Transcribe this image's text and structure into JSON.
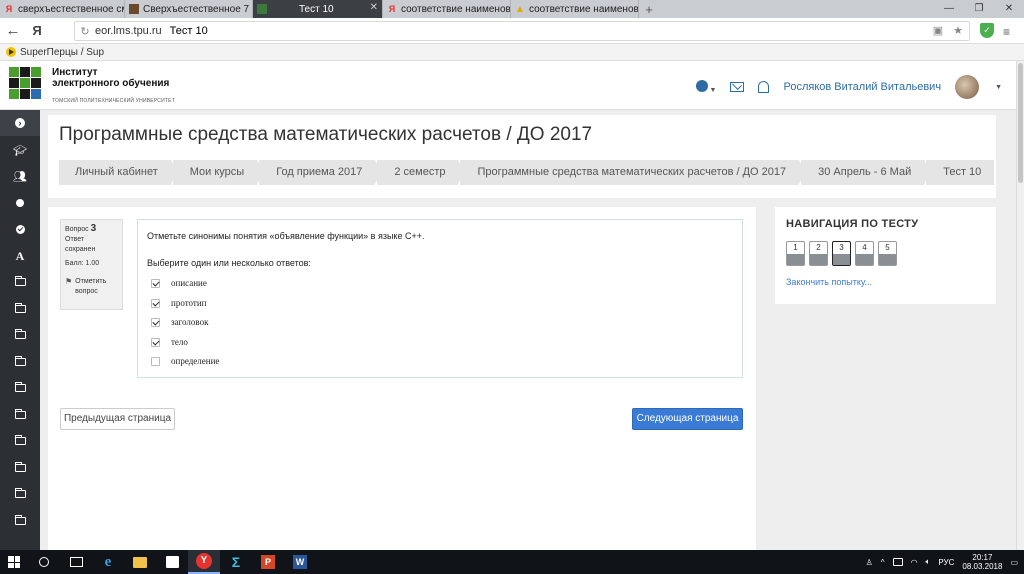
{
  "browser": {
    "tabs": [
      {
        "label": "сверхъестественное смотр",
        "icon": "yandex-icon",
        "active": false
      },
      {
        "label": "Сверхъестественное 7 сезо",
        "icon": "image-thumbnail-icon",
        "active": false
      },
      {
        "label": "Тест 10",
        "icon": "lms-favicon-icon",
        "active": true
      },
      {
        "label": "соответствие наименован",
        "icon": "yandex-icon",
        "active": false
      },
      {
        "label": "соответствие наименован",
        "icon": "warning-icon",
        "active": false
      }
    ],
    "domain": "eor.lms.tpu.ru",
    "page_title": "Тест 10",
    "bookmark": "SuperПерцы / Sup"
  },
  "header": {
    "org_line1": "Институт",
    "org_line2": "электронного обучения",
    "org_sub": "ТОМСКИЙ ПОЛИТЕХНИЧЕСКИЙ УНИВЕРСИТЕТ",
    "user_name": "Росляков Виталий Витальевич"
  },
  "page": {
    "title": "Программные средства математических расчетов / ДО 2017",
    "breadcrumbs": [
      "Личный кабинет",
      "Мои курсы",
      "Год приема 2017",
      "2 семестр",
      "Программные средства математических расчетов / ДО 2017",
      "30 Апрель - 6 Май",
      "Тест 10"
    ]
  },
  "question": {
    "label": "Вопрос",
    "number": "3",
    "state_line1": "Ответ",
    "state_line2": "сохранен",
    "grade": "Балл: 1.00",
    "flag_line1": "Отметить",
    "flag_line2": "вопрос",
    "text": "Отметьте синонимы понятия «объявление функции» в языке С++.",
    "hint": "Выберите один или несколько ответов:",
    "options": [
      {
        "label": "описание",
        "checked": true
      },
      {
        "label": "прототип",
        "checked": true
      },
      {
        "label": "заголовок",
        "checked": true
      },
      {
        "label": "тело",
        "checked": true
      },
      {
        "label": "определение",
        "checked": false
      }
    ]
  },
  "buttons": {
    "prev": "Предыдущая страница",
    "next": "Следующая страница"
  },
  "quiz_nav": {
    "title": "НАВИГАЦИЯ ПО ТЕСТУ",
    "questions": [
      "1",
      "2",
      "3",
      "4",
      "5"
    ],
    "current": "3",
    "finish": "Закончить попытку..."
  },
  "taskbar": {
    "lang": "РУС",
    "time": "20:17",
    "date": "08.03.2018"
  },
  "colors": {
    "accent": "#3a7bd5",
    "sidebar": "#2c2f33",
    "tab_active": "#3c3f44"
  }
}
